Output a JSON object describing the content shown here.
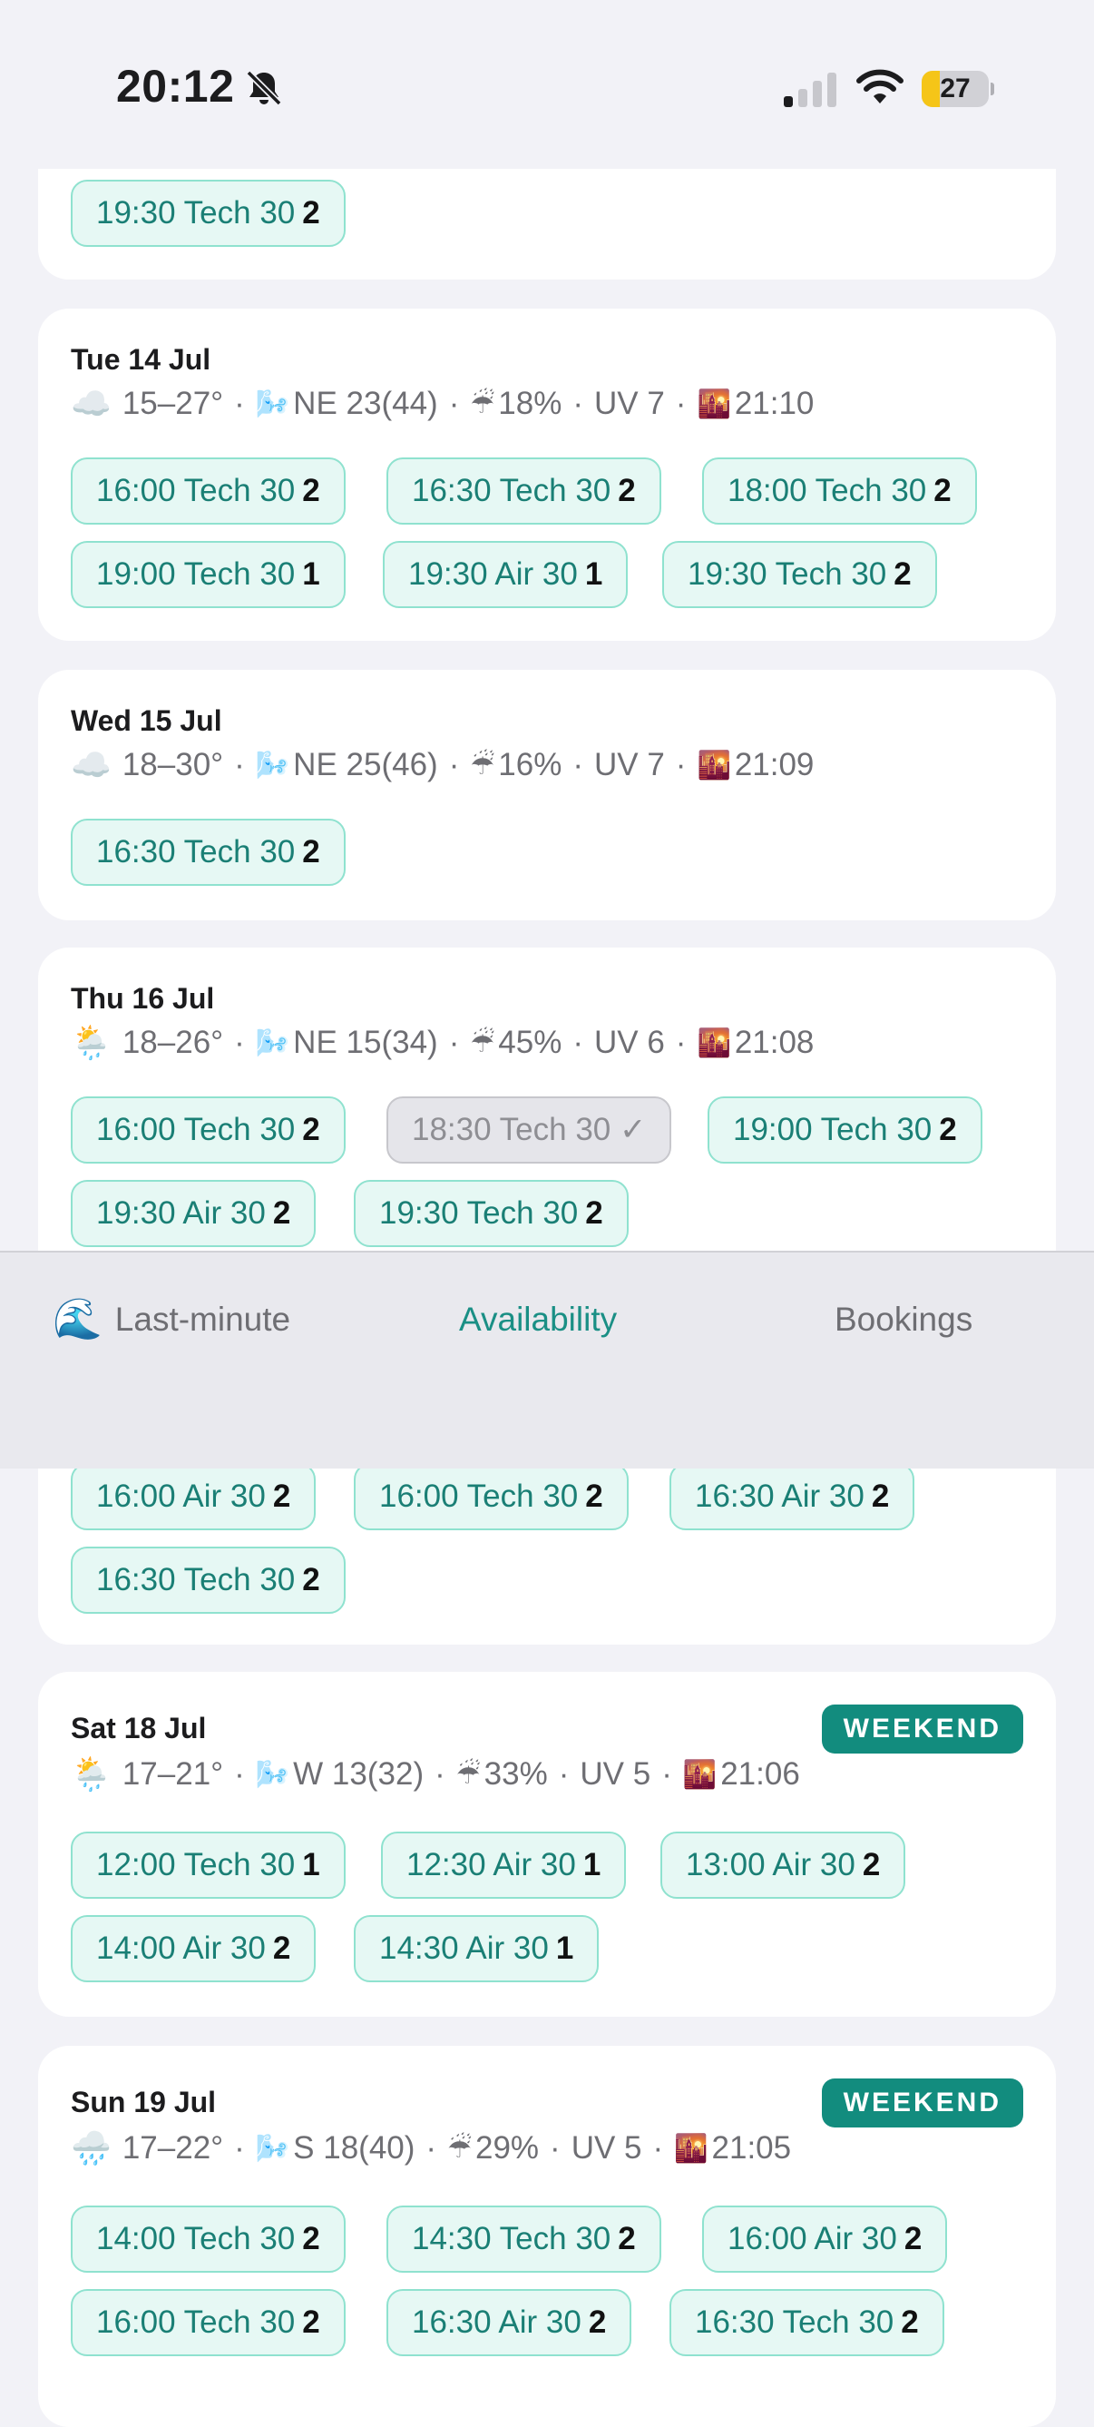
{
  "status": {
    "time": "20:12",
    "battery": "27",
    "battery_level_percent": 27,
    "icons": [
      "bell-slash-icon",
      "cellular-signal-icon",
      "wifi-icon",
      "battery-icon"
    ]
  },
  "days": [
    {
      "date": "",
      "weather": null,
      "slots": [
        {
          "label": "19:30 Tech 30",
          "count": "2"
        }
      ]
    },
    {
      "date": "Tue 14 Jul",
      "weather": {
        "icon": "☁️",
        "temp": "15–27°",
        "wind": "NE 23(44)",
        "rain": "18%",
        "uv": "UV 7",
        "sunset": "21:10"
      },
      "slots": [
        {
          "label": "16:00 Tech 30",
          "count": "2"
        },
        {
          "label": "16:30 Tech 30",
          "count": "2"
        },
        {
          "label": "18:00 Tech 30",
          "count": "2"
        },
        {
          "label": "19:00 Tech 30",
          "count": "1"
        },
        {
          "label": "19:30 Air 30",
          "count": "1"
        },
        {
          "label": "19:30 Tech 30",
          "count": "2"
        }
      ]
    },
    {
      "date": "Wed 15 Jul",
      "weather": {
        "icon": "☁️",
        "temp": "18–30°",
        "wind": "NE 25(46)",
        "rain": "16%",
        "uv": "UV 7",
        "sunset": "21:09"
      },
      "slots": [
        {
          "label": "16:30 Tech 30",
          "count": "2"
        }
      ]
    },
    {
      "date": "Thu 16 Jul",
      "weather": {
        "icon": "🌦️",
        "temp": "18–26°",
        "wind": "NE 15(34)",
        "rain": "45%",
        "uv": "UV 6",
        "sunset": "21:08"
      },
      "slots": [
        {
          "label": "16:00 Tech 30",
          "count": "2"
        },
        {
          "label": "18:30 Tech 30 ✓",
          "count": "",
          "booked": true
        },
        {
          "label": "19:00 Tech 30",
          "count": "2"
        },
        {
          "label": "19:30 Air 30",
          "count": "2"
        },
        {
          "label": "19:30 Tech 30",
          "count": "2"
        }
      ]
    },
    {
      "date": "",
      "weather": null,
      "slots": [
        {
          "label": "16:00 Air 30",
          "count": "2"
        },
        {
          "label": "16:00 Tech 30",
          "count": "2"
        },
        {
          "label": "16:30 Air 30",
          "count": "2"
        },
        {
          "label": "16:30 Tech 30",
          "count": "2"
        }
      ]
    },
    {
      "date": "Sat 18 Jul",
      "badge": "WEEKEND",
      "weather": {
        "icon": "🌦️",
        "temp": "17–21°",
        "wind": "W 13(32)",
        "rain": "33%",
        "uv": "UV 5",
        "sunset": "21:06"
      },
      "slots": [
        {
          "label": "12:00 Tech 30",
          "count": "1"
        },
        {
          "label": "12:30 Air 30",
          "count": "1"
        },
        {
          "label": "13:00 Air 30",
          "count": "2"
        },
        {
          "label": "14:00 Air 30",
          "count": "2"
        },
        {
          "label": "14:30 Air 30",
          "count": "1"
        }
      ]
    },
    {
      "date": "Sun 19 Jul",
      "badge": "WEEKEND",
      "weather": {
        "icon": "🌧️",
        "temp": "17–22°",
        "wind": "S 18(40)",
        "rain": "29%",
        "uv": "UV 5",
        "sunset": "21:05"
      },
      "slots": [
        {
          "label": "14:00 Tech 30",
          "count": "2"
        },
        {
          "label": "14:30 Tech 30",
          "count": "2"
        },
        {
          "label": "16:00 Air 30",
          "count": "2"
        },
        {
          "label": "16:00 Tech 30",
          "count": "2"
        },
        {
          "label": "16:30 Air 30",
          "count": "2"
        },
        {
          "label": "16:30 Tech 30",
          "count": "2"
        }
      ]
    }
  ],
  "weather_glyphs": {
    "wind": "🌬️",
    "rain": "☔",
    "sunset": "🌇",
    "sep": "·"
  },
  "tabs": [
    {
      "icon": "🌊",
      "label": "Last-minute",
      "active": false
    },
    {
      "icon": "",
      "label": "Availability",
      "active": true
    },
    {
      "icon": "",
      "label": "Bookings",
      "active": false
    }
  ],
  "colors": {
    "accent": "#1a8f85",
    "chip_bg": "#e6f8f4",
    "chip_border": "#8fe2cf",
    "badge_bg": "#128c7e"
  }
}
